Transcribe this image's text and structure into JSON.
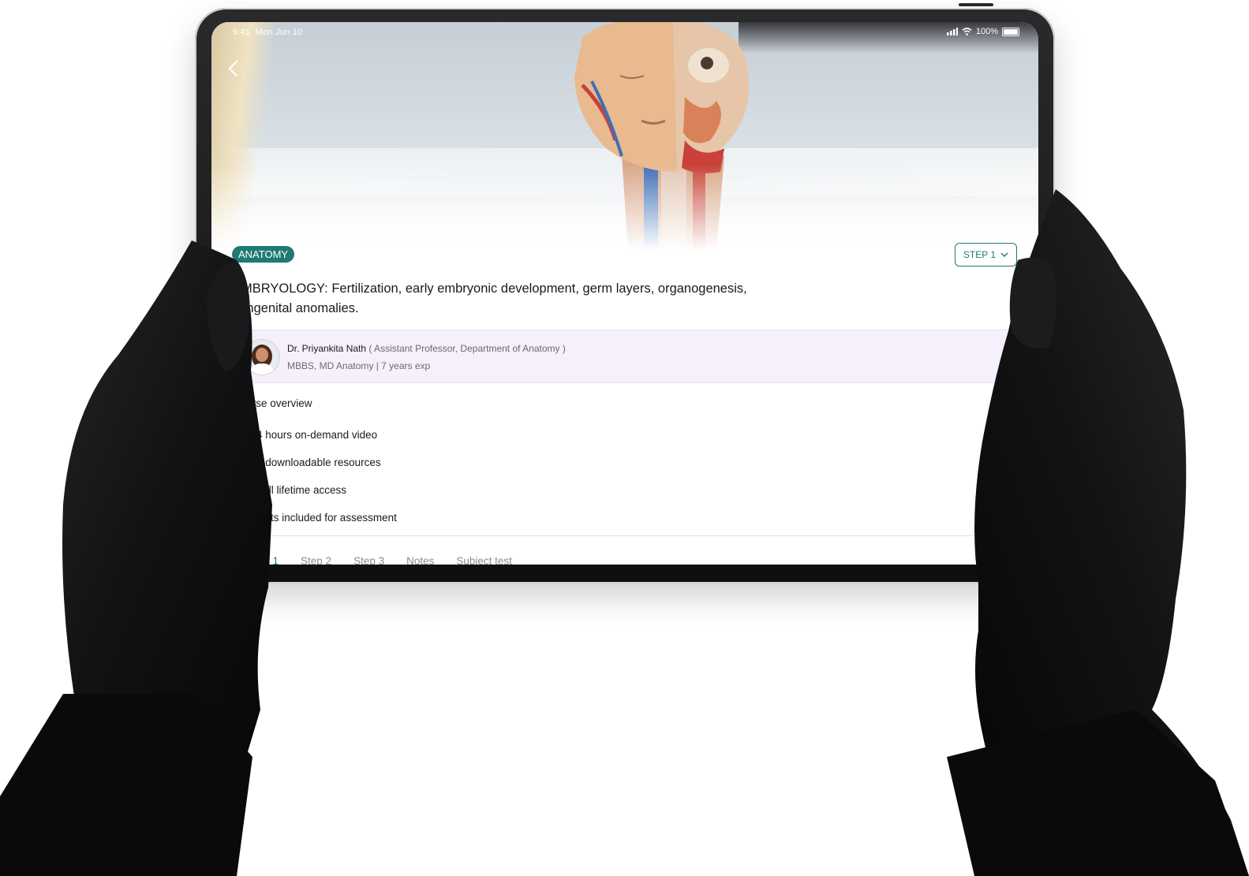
{
  "status_bar": {
    "time": "9:41",
    "date": "Mon Jun 10",
    "battery": "100%"
  },
  "course": {
    "subject_badge": "ANATOMY",
    "step_selector": "STEP 1",
    "title": "EMBRYOLOGY: Fertilization, early embryonic development, germ layers, organogenesis, congenital anomalies."
  },
  "instructor": {
    "name": "Dr. Priyankita Nath",
    "role": "( Assistant Professor, Department of Anatomy )",
    "qualifications": "MBBS, MD Anatomy | 7 years exp"
  },
  "overview": {
    "heading": "Course overview",
    "items": [
      "4 hours on-demand video",
      "5 downloadable resources",
      "Full lifetime access",
      "tests included for assessment"
    ]
  },
  "tabs": [
    "Step 1",
    "Step 2",
    "Step 3",
    "Notes",
    "Subject test"
  ],
  "colors": {
    "accent": "#1f7a72",
    "instructor_card_bg": "#f5f0fb"
  },
  "icons": {
    "back": "chevron-left-icon",
    "dropdown": "chevron-down-icon"
  }
}
